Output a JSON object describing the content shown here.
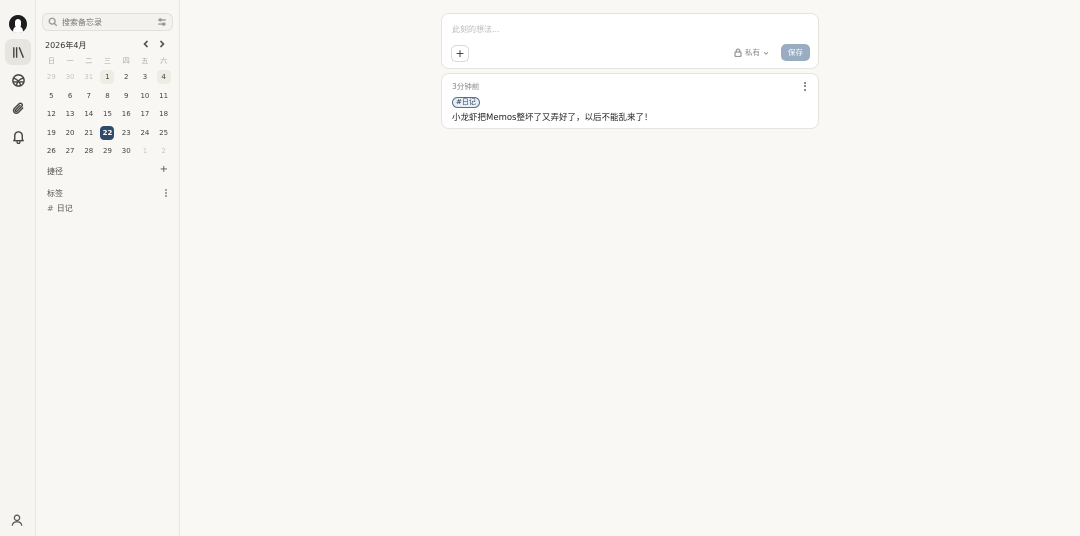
{
  "nav": {
    "items": [
      "avatar",
      "memos-icon",
      "explore-icon",
      "attachments-icon",
      "notifications-icon"
    ],
    "active": "memos-icon"
  },
  "sidebar": {
    "search_placeholder": "搜索备忘录",
    "calendar": {
      "title": "2026年4月",
      "weekdays": [
        "日",
        "一",
        "二",
        "三",
        "四",
        "五",
        "六"
      ],
      "days": [
        {
          "d": "29",
          "m": true
        },
        {
          "d": "30",
          "m": true
        },
        {
          "d": "31",
          "m": true
        },
        {
          "d": "1",
          "h": true
        },
        {
          "d": "2"
        },
        {
          "d": "3"
        },
        {
          "d": "4",
          "h": true
        },
        {
          "d": "5"
        },
        {
          "d": "6"
        },
        {
          "d": "7"
        },
        {
          "d": "8"
        },
        {
          "d": "9"
        },
        {
          "d": "10"
        },
        {
          "d": "11"
        },
        {
          "d": "12"
        },
        {
          "d": "13"
        },
        {
          "d": "14"
        },
        {
          "d": "15"
        },
        {
          "d": "16"
        },
        {
          "d": "17"
        },
        {
          "d": "18"
        },
        {
          "d": "19"
        },
        {
          "d": "20"
        },
        {
          "d": "21"
        },
        {
          "d": "22",
          "t": true
        },
        {
          "d": "23"
        },
        {
          "d": "24"
        },
        {
          "d": "25"
        },
        {
          "d": "26"
        },
        {
          "d": "27"
        },
        {
          "d": "28"
        },
        {
          "d": "29"
        },
        {
          "d": "30"
        },
        {
          "d": "1",
          "m": true
        },
        {
          "d": "2",
          "m": true
        }
      ]
    },
    "shortcuts_label": "捷径",
    "shortcuts_add": "+",
    "tags_label": "标签",
    "tags": [
      {
        "hash": "#",
        "name": "日记"
      }
    ]
  },
  "editor": {
    "placeholder": "此刻的想法...",
    "add_label": "+",
    "visibility_label": "私有",
    "save_label": "保存"
  },
  "memo": {
    "time": "3分钟前",
    "tag": "#日记",
    "content": "小龙虾把Memos整坏了又弄好了，以后不能乱来了！"
  },
  "colors": {
    "accent": "#2f4a6a",
    "save_button": "#9aacc2",
    "background": "#f9f8f5"
  }
}
